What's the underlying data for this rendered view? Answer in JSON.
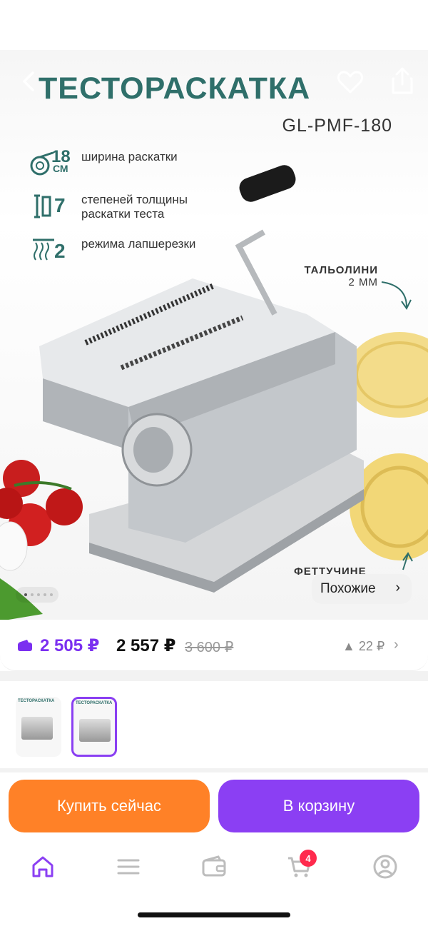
{
  "hero": {
    "title": "ТЕСТОРАСКАТКА",
    "model": "GL-PMF-180",
    "features": [
      {
        "num": "18",
        "unit": "СМ",
        "text": "ширина раскатки"
      },
      {
        "num": "7",
        "text": "степеней толщины раскатки теста"
      },
      {
        "num": "2",
        "text": "режима лапшерезки"
      }
    ],
    "annotation_top": {
      "line1": "ТАЛЬОЛИНИ",
      "line2": "2 ММ"
    },
    "annotation_bottom": "ФЕТТУЧИНЕ",
    "similar_label": "Похожие",
    "similar_chevron": "›"
  },
  "price": {
    "card_price": "2 505 ₽",
    "main_price": "2 557 ₽",
    "old_price": "3 600 ₽",
    "delta": "▲ 22 ₽",
    "chevron": "›"
  },
  "thumbnails": [
    {
      "title": "ТЕСТОРАСКАТКА",
      "selected": false
    },
    {
      "title": "ТЕСТОРАСКАТКА",
      "selected": true
    }
  ],
  "actions": {
    "buy_now": "Купить сейчас",
    "add_to_cart": "В корзину"
  },
  "tabbar": {
    "items": [
      "home-icon",
      "catalog-icon",
      "wallet-icon",
      "cart-icon",
      "profile-icon"
    ],
    "cart_badge": "4"
  },
  "colors": {
    "accent_purple": "#8b3ff3",
    "accent_orange": "#ff8127",
    "title_teal": "#2f6f6a",
    "badge_red": "#ff2a4d"
  }
}
